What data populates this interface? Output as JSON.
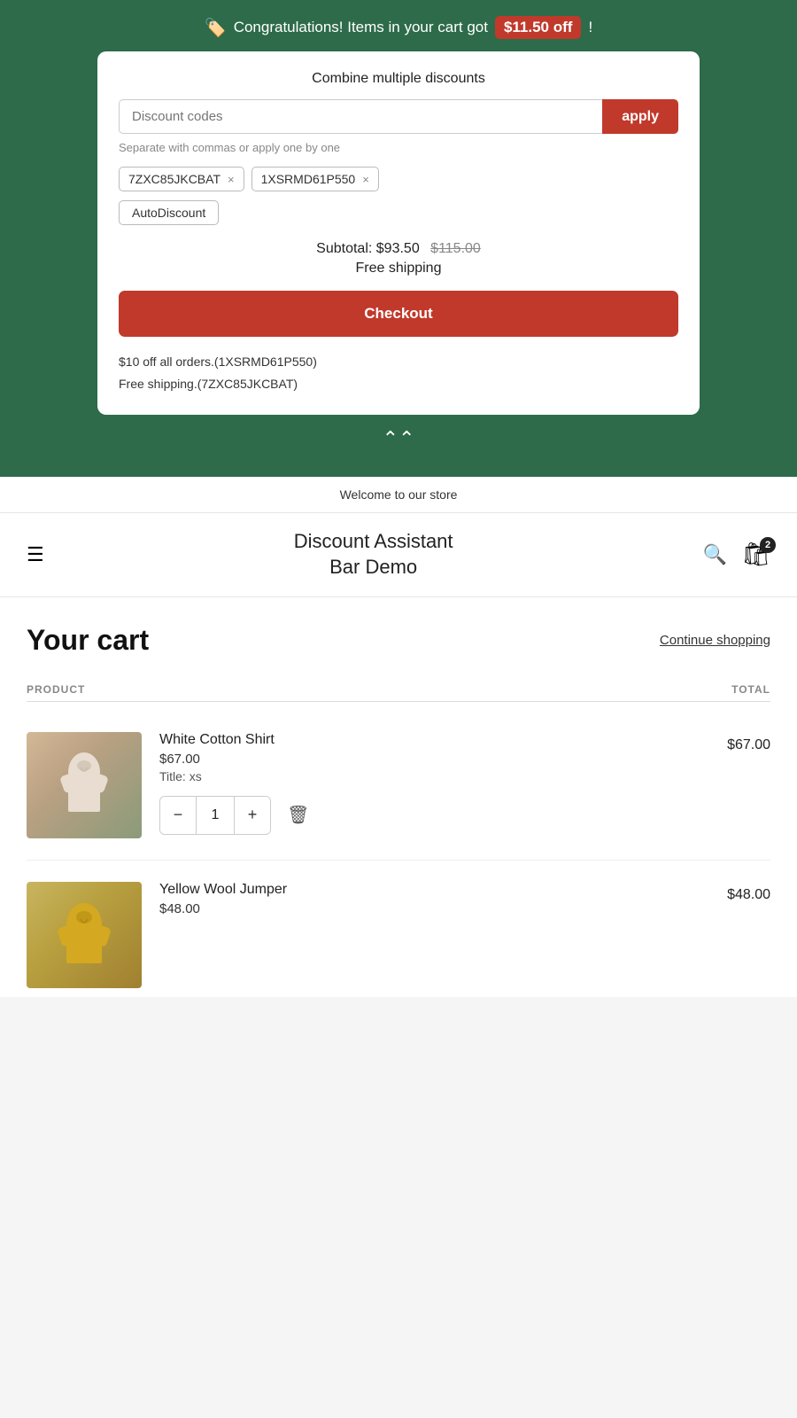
{
  "discountBar": {
    "banner": {
      "icon": "🏷️",
      "text": "Congratulations! Items in your cart got",
      "amount": "$11.50 off",
      "exclamation": "!"
    },
    "panel": {
      "title": "Combine multiple discounts",
      "inputPlaceholder": "Discount codes",
      "applyLabel": "apply",
      "hint": "Separate with commas or apply one by one",
      "codes": [
        {
          "code": "7ZXC85JKCBAT"
        },
        {
          "code": "1XSRMD61P550"
        }
      ],
      "autoDiscount": "AutoDiscount",
      "subtotalLabel": "Subtotal:",
      "subtotalPrice": "$93.50",
      "subtotalOriginal": "$115.00",
      "shippingLabel": "Free shipping",
      "checkoutLabel": "Checkout",
      "notes": [
        "$10 off all orders.(1XSRMD61P550)",
        "Free shipping.(7ZXC85JKCBAT)"
      ]
    }
  },
  "welcomeBar": "Welcome to our store",
  "nav": {
    "title": "Discount Assistant\nBar Demo",
    "cartCount": "2"
  },
  "cartPage": {
    "title": "Your cart",
    "continueShopping": "Continue shopping",
    "columns": {
      "product": "PRODUCT",
      "total": "TOTAL"
    },
    "items": [
      {
        "name": "White Cotton Shirt",
        "price": "$67.00",
        "variant": "Title: xs",
        "quantity": 1,
        "total": "$67.00",
        "imageType": "shirt"
      },
      {
        "name": "Yellow Wool Jumper",
        "price": "$48.00",
        "imageType": "jumper"
      }
    ]
  }
}
